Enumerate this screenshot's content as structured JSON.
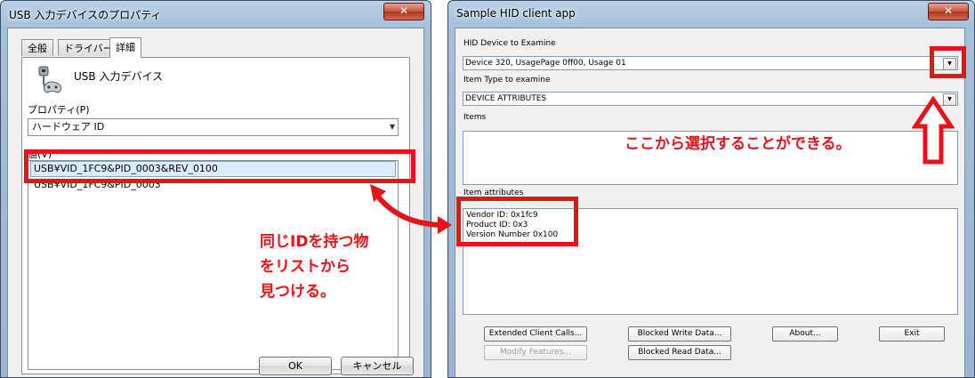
{
  "left_window": {
    "title": "USB 入力デバイスのプロパティ",
    "close_glyph": "✕",
    "tabs": [
      {
        "label": "全般"
      },
      {
        "label": "ドライバー"
      },
      {
        "label": "詳細"
      }
    ],
    "device_name": "USB 入力デバイス",
    "property_label": "プロパティ(P)",
    "property_value": "ハードウェア ID",
    "value_label": "値(V)",
    "values": [
      "USB¥VID_1FC9&PID_0003&REV_0100",
      "USB¥VID_1FC9&PID_0003"
    ],
    "ok_label": "OK",
    "cancel_label": "キャンセル"
  },
  "right_window": {
    "title": "Sample HID client app",
    "close_glyph": "✕",
    "hid_device_label": "HID Device to Examine",
    "hid_device_value": "Device 320, UsagePage 0ff00, Usage 01",
    "item_type_label": "Item Type to examine",
    "item_type_value": "DEVICE ATTRIBUTES",
    "items_label": "Items",
    "item_attributes_label": "Item attributes",
    "attributes": [
      "Vendor ID: 0x1fc9",
      "Product ID: 0x3",
      "Version Number  0x100"
    ],
    "buttons": {
      "extended": "Extended Client Calls...",
      "modify": "Modify Features...",
      "blocked_write": "Blocked Write Data...",
      "blocked_read": "Blocked Read Data...",
      "about": "About...",
      "exit": "Exit"
    }
  },
  "annotations": {
    "right_note": "ここから選択することができる。",
    "left_note_lines": [
      "同じIDを持つ物",
      "をリストから",
      "見つける。"
    ],
    "accent_color": "#e8121b"
  }
}
